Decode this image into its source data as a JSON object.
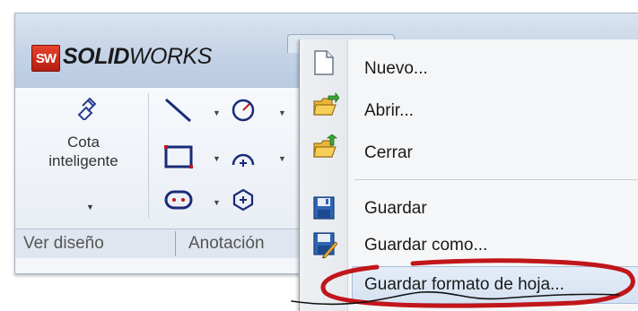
{
  "app": {
    "brand_bold": "SOLID",
    "brand_light": "WORKS",
    "logo_text": "SW"
  },
  "ribbon": {
    "cota_label_line1": "Cota",
    "cota_label_line2": "inteligente"
  },
  "tabs": [
    {
      "label": "Ver diseño"
    },
    {
      "label": "Anotación"
    }
  ],
  "file_menu": {
    "items": [
      {
        "label": "Nuevo...",
        "icon": "new-document-icon"
      },
      {
        "label": "Abrir...",
        "icon": "open-folder-icon"
      },
      {
        "label": "Cerrar",
        "icon": "close-folder-icon"
      },
      {
        "label": "Guardar",
        "icon": "save-disk-icon"
      },
      {
        "label": "Guardar como...",
        "icon": "save-as-icon"
      },
      {
        "label": "Guardar formato de hoja...",
        "icon": ""
      }
    ]
  },
  "colors": {
    "annotation_ellipse": "#c0161b",
    "highlight": "#d6e2f2",
    "logo_red": "#c9291a"
  }
}
